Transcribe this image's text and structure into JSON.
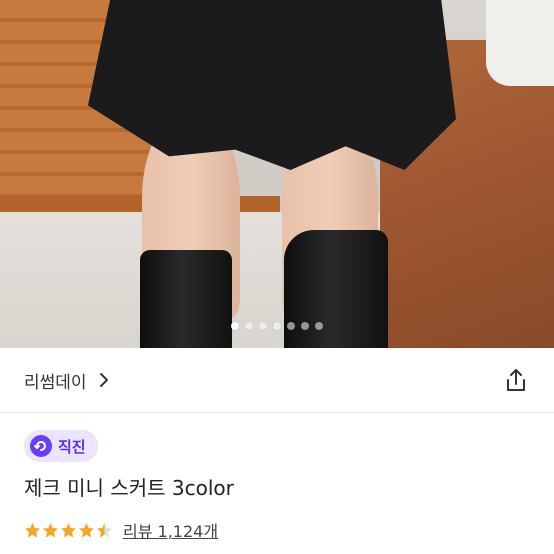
{
  "gallery": {
    "slide_count": 7,
    "active_slide": 1
  },
  "seller": {
    "name": "리썸데이"
  },
  "product": {
    "badge_label": "직진",
    "title": "제크 미니 스커트 3color",
    "rating": 4.5,
    "review_text": "리뷰 1,124개"
  },
  "icons": {
    "chevron": "chevron-right-icon",
    "share": "share-icon",
    "badge": "direct-delivery-icon",
    "star": "star-icon"
  },
  "colors": {
    "accent": "#6a3dfc",
    "badge_bg": "#ece5ff",
    "star": "#f5a623"
  }
}
